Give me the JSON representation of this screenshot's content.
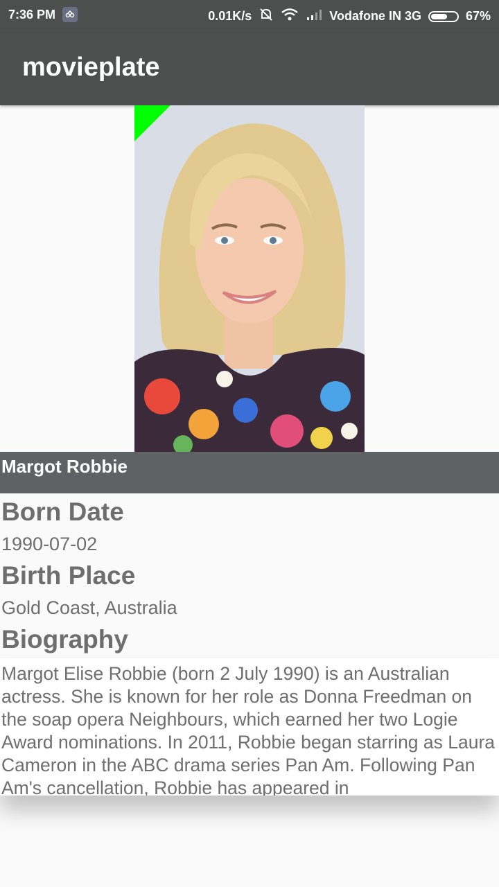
{
  "status_bar": {
    "time": "7:36 PM",
    "speed": "0.01K/s",
    "carrier": "Vodafone IN 3G",
    "battery": "67%",
    "battery_level": 0.67,
    "icons": [
      "notification-app-icon",
      "mute-bell-icon",
      "wifi-icon",
      "signal-icon",
      "battery-icon"
    ]
  },
  "app_bar": {
    "title": "movieplate"
  },
  "profile": {
    "name": "Margot Robbie",
    "photo_icon": "person-photo",
    "corner_badge_color": "#00ff00"
  },
  "details": {
    "born_date_label": "Born Date",
    "born_date": "1990-07-02",
    "birth_place_label": "Birth Place",
    "birth_place": "Gold Coast, Australia",
    "biography_label": "Biography",
    "biography": "Margot Elise Robbie (born 2 July 1990) is an Australian actress. She is known for her role as Donna Freedman on the soap opera Neighbours, which earned her two Logie Award nominations. In 2011, Robbie began starring as Laura Cameron in the ABC drama series Pan Am. Following Pan Am's cancellation, Robbie has appeared in"
  },
  "colors": {
    "app_bar": "#4d4f4f",
    "name_bar": "#5f6262",
    "text": "#6e6e6e",
    "background": "#fafafa"
  }
}
